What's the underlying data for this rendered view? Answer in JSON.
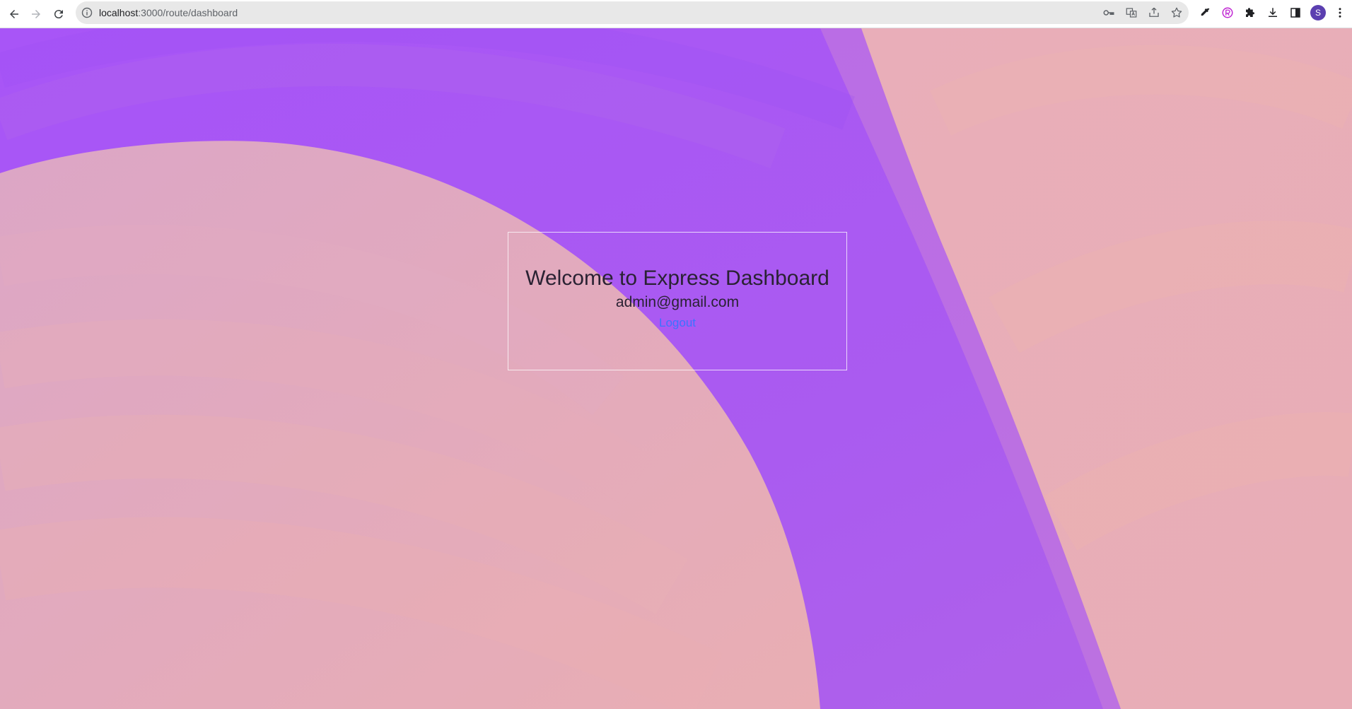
{
  "browser": {
    "url_host": "localhost",
    "url_path": ":3000/route/dashboard",
    "profile_initial": "S"
  },
  "dashboard": {
    "title": "Welcome to Express Dashboard",
    "email": "admin@gmail.com",
    "logout_label": "Logout"
  },
  "colors": {
    "purple": "#a855f7",
    "pink": "#e8aeb4",
    "link": "#3b73ff"
  },
  "icons": [
    "back-icon",
    "forward-icon",
    "reload-icon",
    "site-info-icon",
    "key-icon",
    "translate-icon",
    "share-icon",
    "star-icon",
    "eyedropper-icon",
    "extension-badge-icon",
    "puzzle-icon",
    "download-icon",
    "side-panel-icon",
    "kebab-menu-icon"
  ]
}
